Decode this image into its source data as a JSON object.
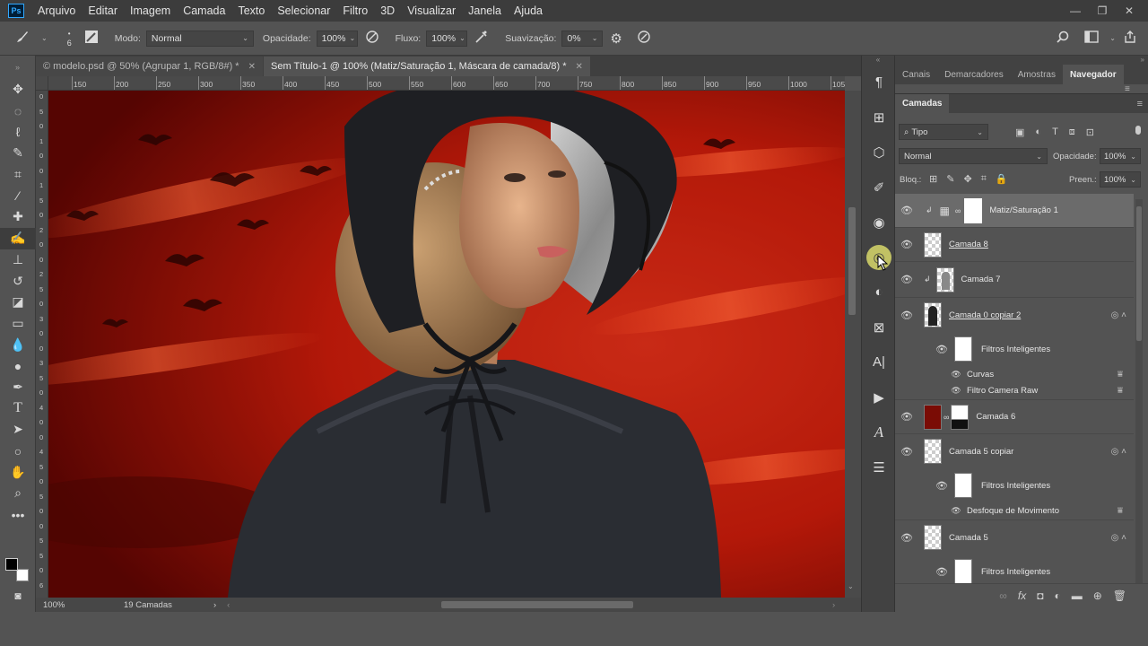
{
  "menu": {
    "logo": "Ps",
    "items": [
      "Arquivo",
      "Editar",
      "Imagem",
      "Camada",
      "Texto",
      "Selecionar",
      "Filtro",
      "3D",
      "Visualizar",
      "Janela",
      "Ajuda"
    ],
    "window_controls": [
      "—",
      "❐",
      "✕"
    ]
  },
  "options": {
    "brush_size": "6",
    "mode_label": "Modo:",
    "mode_value": "Normal",
    "opacity_label": "Opacidade:",
    "opacity_value": "100%",
    "flow_label": "Fluxo:",
    "flow_value": "100%",
    "smoothing_label": "Suavização:",
    "smoothing_value": "0%"
  },
  "tabs": [
    {
      "label": "© modelo.psd @ 50% (Agrupar 1, RGB/8#) *",
      "active": false
    },
    {
      "label": "Sem Título-1 @ 100% (Matiz/Saturação 1, Máscara de camada/8) *",
      "active": true
    }
  ],
  "ruler": {
    "h_ticks": [
      "150",
      "200",
      "250",
      "300",
      "350",
      "400",
      "450",
      "500",
      "550",
      "600",
      "650",
      "700",
      "750",
      "800",
      "850",
      "900",
      "950",
      "1000",
      "1050"
    ],
    "v_ticks": [
      "0",
      "5",
      "0",
      "1",
      "0",
      "0",
      "1",
      "5",
      "0",
      "2",
      "0",
      "0",
      "2",
      "5",
      "0",
      "3",
      "0",
      "0",
      "3",
      "5",
      "0",
      "4",
      "0",
      "0",
      "4",
      "5",
      "0",
      "5",
      "0",
      "0",
      "5",
      "5",
      "0",
      "6"
    ]
  },
  "status": {
    "zoom": "100%",
    "doc_info": "19 Camadas"
  },
  "panels": {
    "top_tabs": [
      "Canais",
      "Demarcadores",
      "Amostras",
      "Navegador"
    ],
    "layers_tab": "Camadas",
    "filter_kind": "Tipo",
    "blend_mode": "Normal",
    "opacity_label": "Opacidade:",
    "opacity_value": "100%",
    "lock_label": "Bloq.:",
    "fill_label": "Preen.:",
    "fill_value": "100%"
  },
  "layers": [
    {
      "name": "Matiz/Saturação 1",
      "kind": "adjustment"
    },
    {
      "name": "Camada 8",
      "kind": "empty"
    },
    {
      "name": "Camada 7",
      "kind": "figure"
    },
    {
      "name": "Camada 0 copiar 2",
      "kind": "smart"
    },
    {
      "name": "Filtros Inteligentes",
      "kind": "filter-head"
    },
    {
      "name": "Curvas",
      "kind": "filter"
    },
    {
      "name": "Filtro Camera Raw",
      "kind": "filter"
    },
    {
      "name": "Camada 6",
      "kind": "masked"
    },
    {
      "name": "Camada 5 copiar",
      "kind": "smart"
    },
    {
      "name": "Filtros Inteligentes",
      "kind": "filter-head"
    },
    {
      "name": "Desfoque de Movimento",
      "kind": "filter"
    },
    {
      "name": "Camada 5",
      "kind": "smart"
    },
    {
      "name": "Filtros Inteligentes",
      "kind": "filter-head"
    }
  ]
}
